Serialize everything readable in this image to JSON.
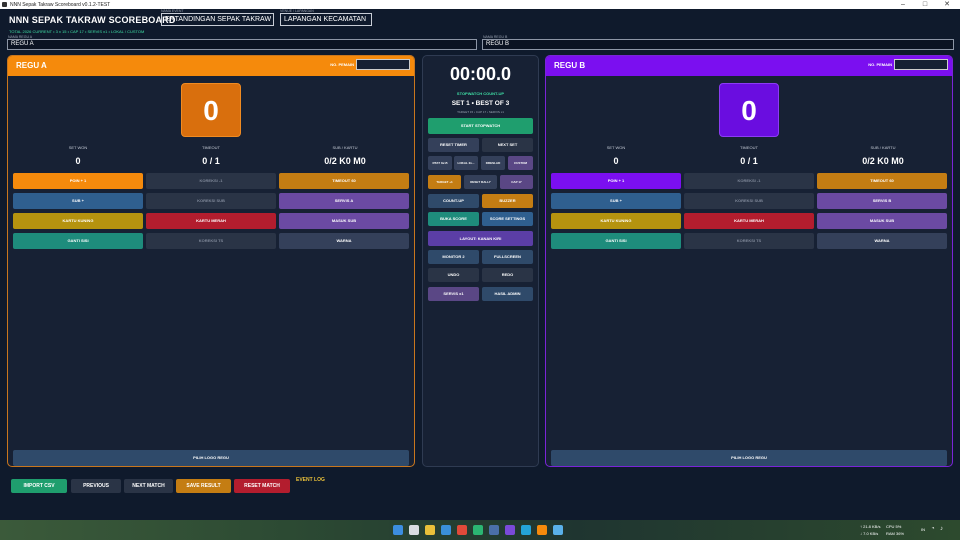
{
  "window": {
    "title": "NNN Sepak Takraw Scoreboard v0.1.2-TEST",
    "min": "–",
    "max": "□",
    "close": "✕"
  },
  "header": {
    "app_title": "NNN SEPAK TAKRAW SCOREBOARD",
    "subinfo": "TOTAL 2026 CURRENT • 3 x 15 • CAP 17 • SERVIS x1 • LOKAL / CUSTOM",
    "event_label": "NAMA EVENT",
    "event_value": "ERTANDINGAN SEPAK TAKRAW",
    "venue_label": "VENUE / LAPANGAN",
    "venue_value": "LAPANGAN KECAMATAN",
    "team_a_label": "NAMA REGU A",
    "team_a_value": "REGU A",
    "team_b_label": "NAMA REGU B",
    "team_b_value": "REGU B"
  },
  "team_a": {
    "name": "REGU A",
    "no_label": "NO. PEMAIN",
    "score": "0",
    "set_won_label": "SET WON",
    "set_won": "0",
    "timeout_label": "TIMEOUT",
    "timeout": "0 / 1",
    "sub_label": "SUB / KARTU",
    "sub": "0/2  K0 M0",
    "buttons": {
      "poin": "POIN + 1",
      "koreksi": "KOREKSI -1",
      "timeout": "TIMEOUT 60",
      "sub": "SUB +",
      "koreksi_sub": "KOREKSI SUB",
      "servis": "SERVIS A",
      "kartu_kuning": "KARTU KUNING",
      "kartu_merah": "KARTU MERAH",
      "masuk_sub": "MASUK SUB",
      "ganti_sisi": "GANTI SISI",
      "koreksi_ts": "KOREKSI TS",
      "warna": "WARNA",
      "logo": "PILIH LOGO REGU"
    }
  },
  "team_b": {
    "name": "REGU B",
    "no_label": "NO. PEMAIN",
    "score": "0",
    "set_won_label": "SET WON",
    "set_won": "0",
    "timeout_label": "TIMEOUT",
    "timeout": "0 / 1",
    "sub_label": "SUB / KARTU",
    "sub": "0/2  K0 M0",
    "buttons": {
      "poin": "POIN + 1",
      "koreksi": "KOREKSI -1",
      "timeout": "TIMEOUT 60",
      "sub": "SUB +",
      "koreksi_sub": "KOREKSI SUB",
      "servis": "SERVIS B",
      "kartu_kuning": "KARTU KUNING",
      "kartu_merah": "KARTU MERAH",
      "masuk_sub": "MASUK SUB",
      "ganti_sisi": "GANTI SISI",
      "koreksi_ts": "KOREKSI TS",
      "warna": "WARNA",
      "logo": "PILIH LOGO REGU"
    }
  },
  "center": {
    "timer": "00:00.0",
    "stopwatch_label": "STOPWATCH COUNT-UP",
    "set_info": "SET 1 • BEST OF 3",
    "set_sub": "TARGET 15 • CAP 17 • SERVIS x1",
    "start": "START STOPWATCH",
    "reset_timer": "RESET TIMER",
    "next_set": "NEXT SET",
    "preset_1": "RTAT 3x15",
    "preset_2": "LOKAL 2x...",
    "preset_3": "DRESLAD",
    "preset_4": "CUSTOM",
    "target": "TARGET +1",
    "reset_rally": "RESET RALLY",
    "cap": "CAP 17",
    "count_up": "COUNT-UP",
    "buzzer": "BUZZER",
    "buka_score": "BUKA SCORE",
    "score_settings": "SCORE SETTINGS",
    "layout": "LAYOUT: KANAN  KIRI",
    "monitor": "MONITOR 2",
    "fullscreen": "FULLSCREEN",
    "undo": "UNDO",
    "redo": "REDO",
    "servis_x1": "SERVIS x1",
    "hasil_admin": "HASIL ADMIN"
  },
  "footer": {
    "import": "IMPORT CSV",
    "previous": "PREVIOUS",
    "next_match": "NEXT MATCH",
    "save": "SAVE RESULT",
    "reset": "RESET MATCH",
    "event_log": "EVENT LOG"
  },
  "taskbar": {
    "net_up": "↑ 21.8 KB/s",
    "net_down": "↓ 7.0 KB/s",
    "cpu": "CPU 5%",
    "ram": "RAM 36%",
    "lang": "IN",
    "time": "",
    "date": ""
  },
  "colors": {
    "orange": "#f58a0c",
    "purple": "#7b0ff0",
    "blue": "#2f5f8f",
    "teal": "#1e8c7c",
    "mustard": "#b5930f",
    "red": "#b31d2e",
    "violet": "#6b4aa3",
    "green": "#1f9e6e",
    "gold": "#c47d13"
  }
}
